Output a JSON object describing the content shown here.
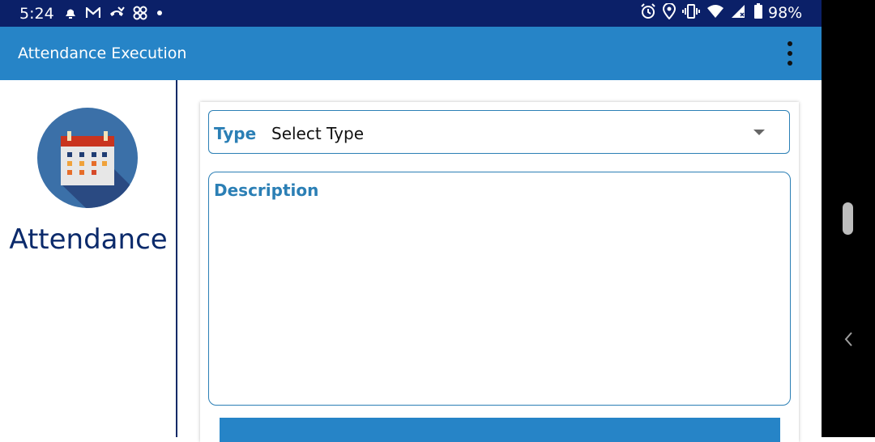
{
  "status_bar": {
    "time": "5:24",
    "battery_percent": "98%",
    "left_icons": [
      "notification-bell-icon",
      "gmail-icon",
      "missed-call-icon",
      "app-notification-icon",
      "dot-icon"
    ],
    "right_icons": [
      "alarm-icon",
      "location-icon",
      "vibrate-icon",
      "wifi-icon",
      "signal-icon",
      "battery-icon"
    ]
  },
  "app_bar": {
    "title": "Attendance Execution",
    "menu_icon": "more-vert-icon"
  },
  "sidebar": {
    "logo_icon": "calendar-icon",
    "label": "Attendance"
  },
  "form": {
    "type_label": "Type",
    "type_value": "Select Type",
    "description_label": "Description",
    "description_value": ""
  },
  "colors": {
    "status_bar": "#0b2068",
    "app_bar": "#2684c7",
    "accent": "#2b7fb5",
    "sidebar_text": "#0b2a6b"
  }
}
